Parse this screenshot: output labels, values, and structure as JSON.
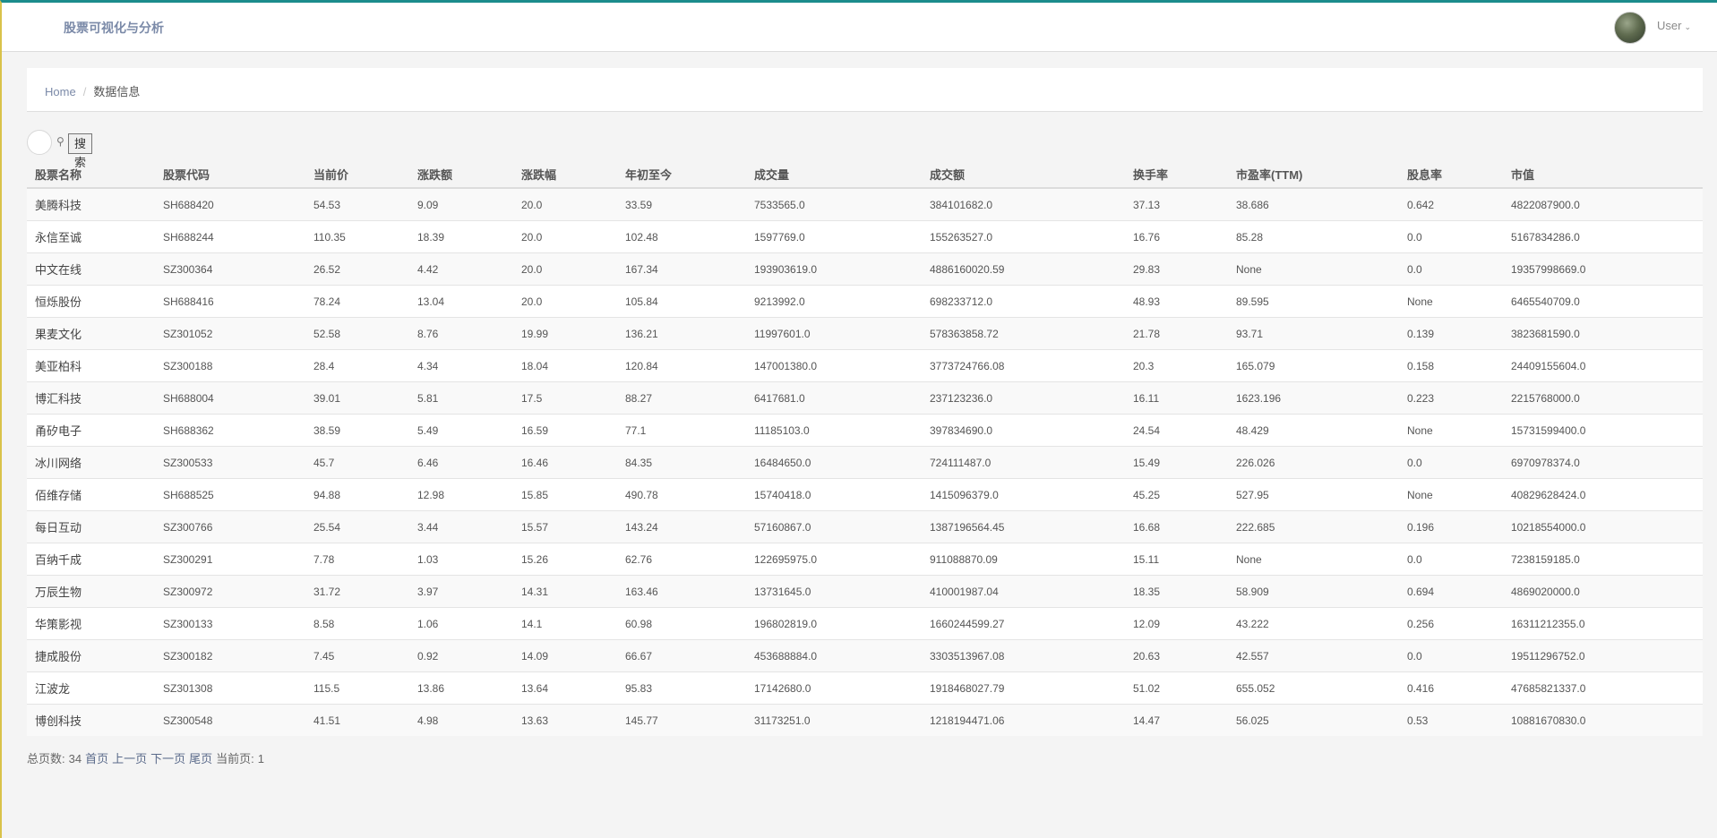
{
  "header": {
    "brand": "股票可视化与分析",
    "user": "User"
  },
  "breadcrumb": {
    "home": "Home",
    "separator": "/",
    "current": "数据信息"
  },
  "search": {
    "placeholder": "",
    "button": "搜索"
  },
  "table": {
    "columns": [
      "股票名称",
      "股票代码",
      "当前价",
      "涨跌额",
      "涨跌幅",
      "年初至今",
      "成交量",
      "成交额",
      "换手率",
      "市盈率(TTM)",
      "股息率",
      "市值"
    ],
    "rows": [
      [
        "美腾科技",
        "SH688420",
        "54.53",
        "9.09",
        "20.0",
        "33.59",
        "7533565.0",
        "384101682.0",
        "37.13",
        "38.686",
        "0.642",
        "4822087900.0"
      ],
      [
        "永信至诚",
        "SH688244",
        "110.35",
        "18.39",
        "20.0",
        "102.48",
        "1597769.0",
        "155263527.0",
        "16.76",
        "85.28",
        "0.0",
        "5167834286.0"
      ],
      [
        "中文在线",
        "SZ300364",
        "26.52",
        "4.42",
        "20.0",
        "167.34",
        "193903619.0",
        "4886160020.59",
        "29.83",
        "None",
        "0.0",
        "19357998669.0"
      ],
      [
        "恒烁股份",
        "SH688416",
        "78.24",
        "13.04",
        "20.0",
        "105.84",
        "9213992.0",
        "698233712.0",
        "48.93",
        "89.595",
        "None",
        "6465540709.0"
      ],
      [
        "果麦文化",
        "SZ301052",
        "52.58",
        "8.76",
        "19.99",
        "136.21",
        "11997601.0",
        "578363858.72",
        "21.78",
        "93.71",
        "0.139",
        "3823681590.0"
      ],
      [
        "美亚柏科",
        "SZ300188",
        "28.4",
        "4.34",
        "18.04",
        "120.84",
        "147001380.0",
        "3773724766.08",
        "20.3",
        "165.079",
        "0.158",
        "24409155604.0"
      ],
      [
        "博汇科技",
        "SH688004",
        "39.01",
        "5.81",
        "17.5",
        "88.27",
        "6417681.0",
        "237123236.0",
        "16.11",
        "1623.196",
        "0.223",
        "2215768000.0"
      ],
      [
        "甬矽电子",
        "SH688362",
        "38.59",
        "5.49",
        "16.59",
        "77.1",
        "11185103.0",
        "397834690.0",
        "24.54",
        "48.429",
        "None",
        "15731599400.0"
      ],
      [
        "冰川网络",
        "SZ300533",
        "45.7",
        "6.46",
        "16.46",
        "84.35",
        "16484650.0",
        "724111487.0",
        "15.49",
        "226.026",
        "0.0",
        "6970978374.0"
      ],
      [
        "佰维存储",
        "SH688525",
        "94.88",
        "12.98",
        "15.85",
        "490.78",
        "15740418.0",
        "1415096379.0",
        "45.25",
        "527.95",
        "None",
        "40829628424.0"
      ],
      [
        "每日互动",
        "SZ300766",
        "25.54",
        "3.44",
        "15.57",
        "143.24",
        "57160867.0",
        "1387196564.45",
        "16.68",
        "222.685",
        "0.196",
        "10218554000.0"
      ],
      [
        "百纳千成",
        "SZ300291",
        "7.78",
        "1.03",
        "15.26",
        "62.76",
        "122695975.0",
        "911088870.09",
        "15.11",
        "None",
        "0.0",
        "7238159185.0"
      ],
      [
        "万辰生物",
        "SZ300972",
        "31.72",
        "3.97",
        "14.31",
        "163.46",
        "13731645.0",
        "410001987.04",
        "18.35",
        "58.909",
        "0.694",
        "4869020000.0"
      ],
      [
        "华策影视",
        "SZ300133",
        "8.58",
        "1.06",
        "14.1",
        "60.98",
        "196802819.0",
        "1660244599.27",
        "12.09",
        "43.222",
        "0.256",
        "16311212355.0"
      ],
      [
        "捷成股份",
        "SZ300182",
        "7.45",
        "0.92",
        "14.09",
        "66.67",
        "453688884.0",
        "3303513967.08",
        "20.63",
        "42.557",
        "0.0",
        "19511296752.0"
      ],
      [
        "江波龙",
        "SZ301308",
        "115.5",
        "13.86",
        "13.64",
        "95.83",
        "17142680.0",
        "1918468027.79",
        "51.02",
        "655.052",
        "0.416",
        "47685821337.0"
      ],
      [
        "博创科技",
        "SZ300548",
        "41.51",
        "4.98",
        "13.63",
        "145.77",
        "31173251.0",
        "1218194471.06",
        "14.47",
        "56.025",
        "0.53",
        "10881670830.0"
      ]
    ]
  },
  "pager": {
    "total_label": "总页数:",
    "total": "34",
    "first": "首页",
    "prev": "上一页",
    "next": "下一页",
    "last": "尾页",
    "current_label": "当前页:",
    "current": "1"
  }
}
